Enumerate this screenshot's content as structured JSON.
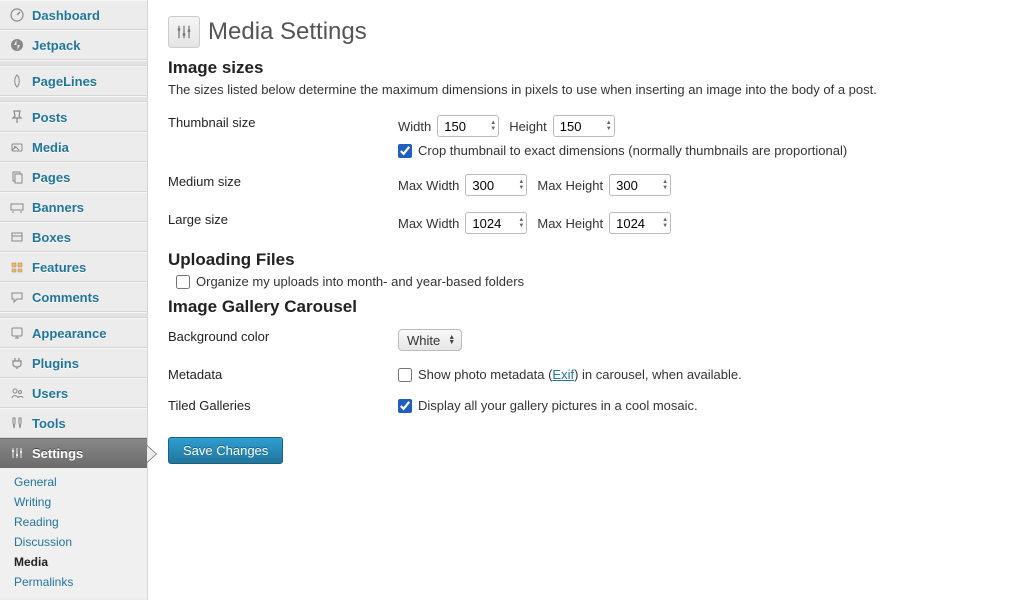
{
  "sidebar": {
    "items": [
      {
        "id": "dashboard",
        "label": "Dashboard"
      },
      {
        "id": "jetpack",
        "label": "Jetpack"
      },
      {
        "sep": true
      },
      {
        "id": "pagelines",
        "label": "PageLines"
      },
      {
        "sep": true
      },
      {
        "id": "posts",
        "label": "Posts"
      },
      {
        "id": "media",
        "label": "Media"
      },
      {
        "id": "pages",
        "label": "Pages"
      },
      {
        "id": "banners",
        "label": "Banners"
      },
      {
        "id": "boxes",
        "label": "Boxes"
      },
      {
        "id": "features",
        "label": "Features"
      },
      {
        "id": "comments",
        "label": "Comments"
      },
      {
        "sep": true
      },
      {
        "id": "appearance",
        "label": "Appearance"
      },
      {
        "id": "plugins",
        "label": "Plugins"
      },
      {
        "id": "users",
        "label": "Users"
      },
      {
        "id": "tools",
        "label": "Tools"
      },
      {
        "id": "settings",
        "label": "Settings",
        "active": true
      }
    ],
    "submenu": [
      {
        "label": "General"
      },
      {
        "label": "Writing"
      },
      {
        "label": "Reading"
      },
      {
        "label": "Discussion"
      },
      {
        "label": "Media",
        "current": true
      },
      {
        "label": "Permalinks"
      }
    ]
  },
  "page": {
    "title": "Media Settings",
    "section_image_sizes": "Image sizes",
    "image_sizes_desc": "The sizes listed below determine the maximum dimensions in pixels to use when inserting an image into the body of a post.",
    "thumbnail": {
      "label": "Thumbnail size",
      "width_label": "Width",
      "width": "150",
      "height_label": "Height",
      "height": "150",
      "crop_label": "Crop thumbnail to exact dimensions (normally thumbnails are proportional)",
      "crop_checked": true
    },
    "medium": {
      "label": "Medium size",
      "maxw_label": "Max Width",
      "maxw": "300",
      "maxh_label": "Max Height",
      "maxh": "300"
    },
    "large": {
      "label": "Large size",
      "maxw_label": "Max Width",
      "maxw": "1024",
      "maxh_label": "Max Height",
      "maxh": "1024"
    },
    "section_uploads": "Uploading Files",
    "uploads_organize_label": "Organize my uploads into month- and year-based folders",
    "uploads_organize_checked": false,
    "section_carousel": "Image Gallery Carousel",
    "carousel": {
      "bg_label": "Background color",
      "bg_value": "White",
      "meta_label": "Metadata",
      "meta_cb_prefix": "Show photo metadata (",
      "meta_link": "Exif",
      "meta_cb_suffix": ") in carousel, when available.",
      "meta_checked": false,
      "tiled_label": "Tiled Galleries",
      "tiled_cb_label": "Display all your gallery pictures in a cool mosaic.",
      "tiled_checked": true
    },
    "save_button": "Save Changes"
  }
}
